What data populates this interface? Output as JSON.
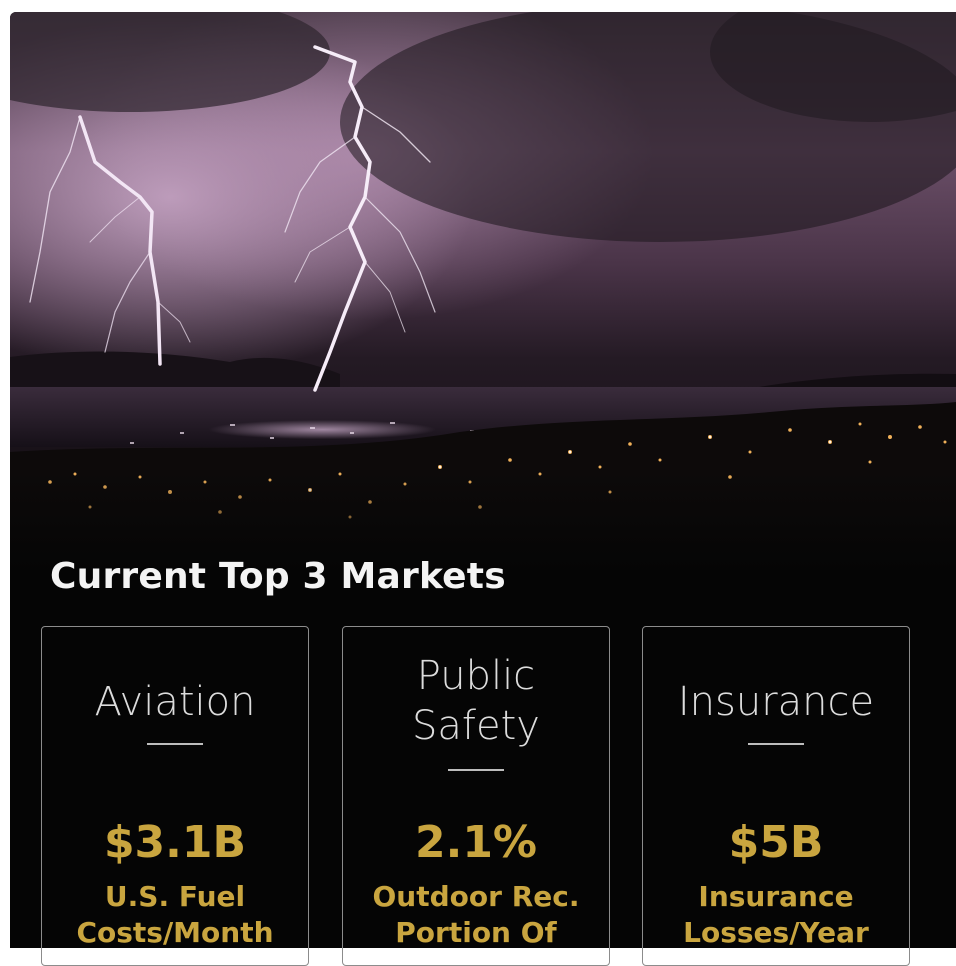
{
  "hero": {
    "image": "lightning-storm-over-bay-at-night"
  },
  "section": {
    "heading": "Current Top 3 Markets"
  },
  "markets": [
    {
      "name": "Aviation",
      "value": "$3.1B",
      "caption": "U.S. Fuel\nCosts/Month"
    },
    {
      "name": "Public\nSafety",
      "value": "2.1%",
      "caption": "Outdoor Rec.\nPortion Of"
    },
    {
      "name": "Insurance",
      "value": "$5B",
      "caption": "Insurance\nLosses/Year"
    }
  ],
  "colors": {
    "background": "#050505",
    "accent_gold": "#c9a53f",
    "heading_text": "#f4f4f4",
    "card_border": "#8c8c8c"
  }
}
